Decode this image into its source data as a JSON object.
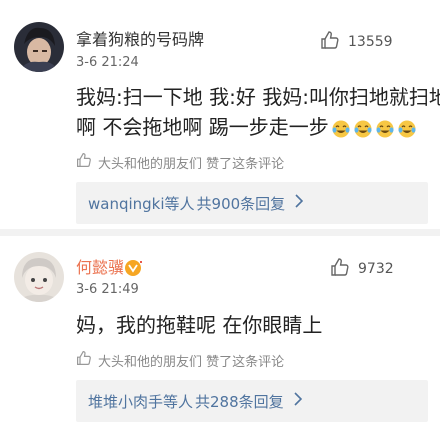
{
  "comments": [
    {
      "username": "拿着狗粮的号码牌",
      "time": "3-6 21:24",
      "likes": "13559",
      "text_lines": [
        "我妈:扫一下地 我:好 我妈:叫你扫地就扫地",
        "啊 不会拖地啊 踢一步走一步"
      ],
      "emoji_count": 4,
      "liked_by": "大头和他的朋友们 赞了这条评论",
      "reply_users": "wanqingki等人",
      "reply_count": "共900条回复"
    },
    {
      "username": "何懿骥",
      "time": "3-6 21:49",
      "likes": "9732",
      "text_lines": [
        "妈，我的拖鞋呢 在你眼睛上"
      ],
      "liked_by": "大头和他的朋友们 赞了这条评论",
      "reply_users": "堆堆小肉手等人",
      "reply_count": "共288条回复"
    }
  ],
  "icons": {
    "like": "thumbs-up-icon",
    "liked_by": "thumbs-up-icon",
    "reply_chevron": "chevron-right-icon",
    "emoji": "laughing-crying-emoji-icon",
    "vip_badge": "vip-badge-icon"
  },
  "colors": {
    "username_highlight": "#eb7350",
    "link_blue": "#50749f",
    "muted_text": "#888888",
    "reply_box_bg": "#f2f2f2"
  }
}
